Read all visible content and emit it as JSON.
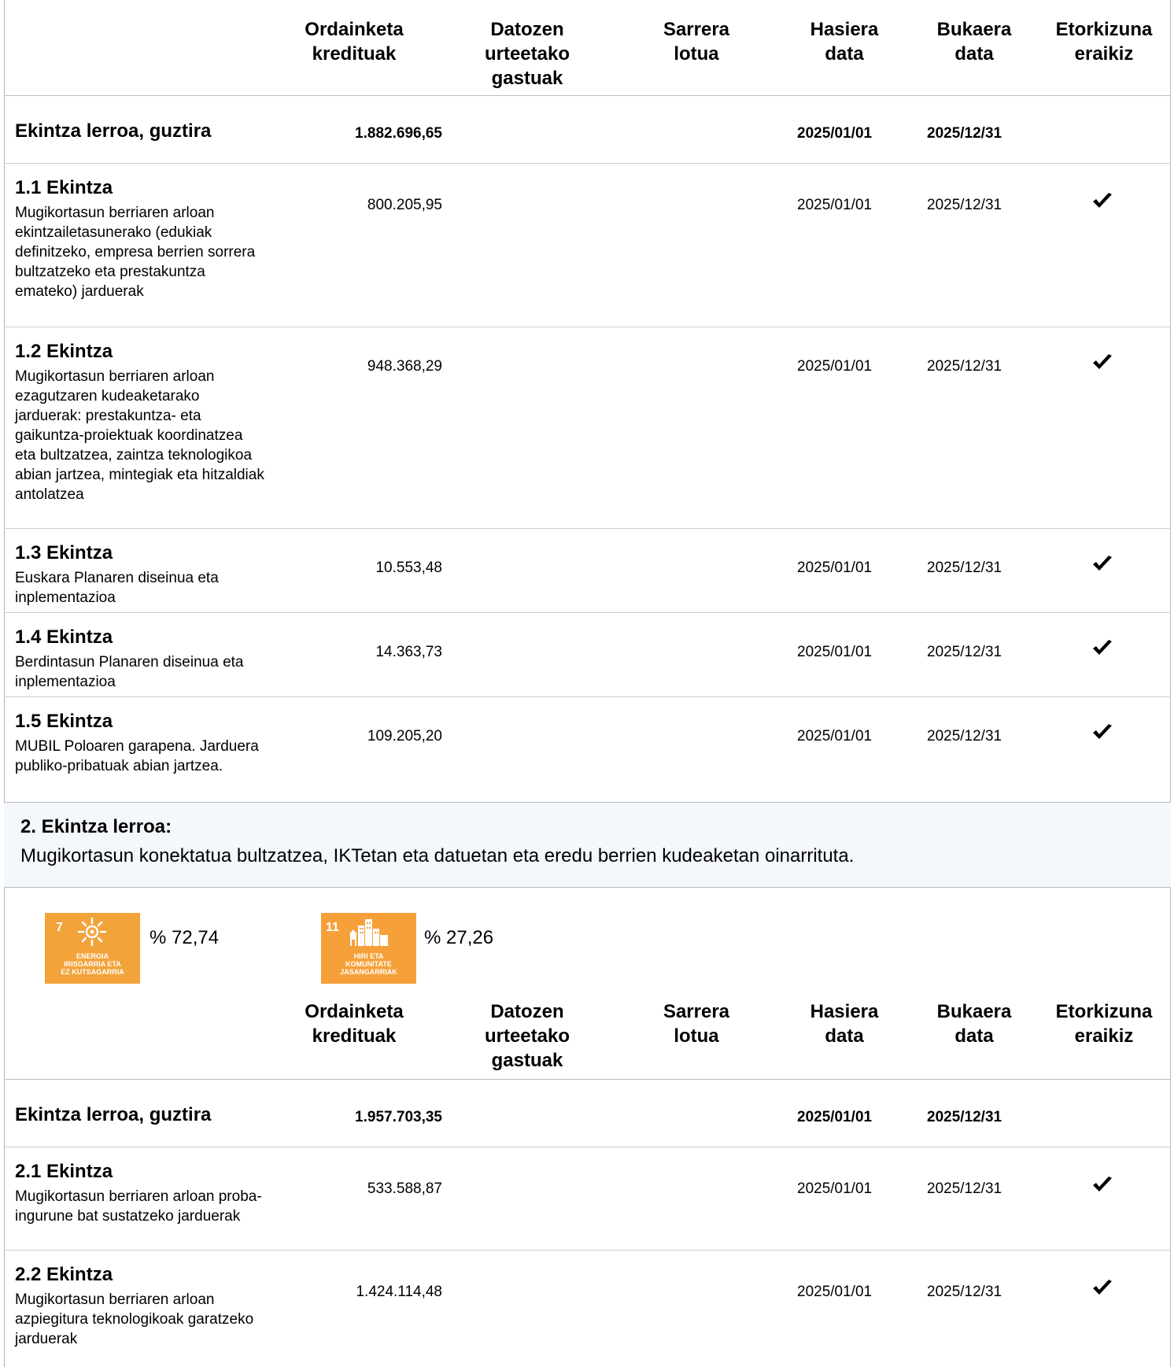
{
  "headers": {
    "credits": [
      "Ordainketa",
      "kredituak"
    ],
    "future": [
      "Datozen",
      "urteetako",
      "gastuak"
    ],
    "income": [
      "Sarrera",
      "lotua"
    ],
    "start": [
      "Hasiera",
      "data"
    ],
    "end": [
      "Bukaera",
      "data"
    ],
    "build": [
      "Etorkizuna",
      "eraikiz"
    ]
  },
  "line1": {
    "total": {
      "label": "Ekintza lerroa, guztira",
      "credits": "1.882.696,65",
      "start": "2025/01/01",
      "end": "2025/12/31"
    },
    "actions": [
      {
        "title": "1.1 Ekintza",
        "desc": "Mugikortasun berriaren arloan ekintzailetasunerako (edukiak definitzeko, empresa berrien sorrera bultzatzeko eta prestakuntza emateko) jarduerak",
        "credits": "800.205,95",
        "start": "2025/01/01",
        "end": "2025/12/31",
        "check": "✔"
      },
      {
        "title": "1.2 Ekintza",
        "desc": "Mugikortasun berriaren arloan ezagutzaren kudeaketarako jarduerak: prestakuntza- eta gaikuntza-proiektuak koordinatzea eta bultzatzea, zaintza teknologikoa abian jartzea, mintegiak eta hitzaldiak antolatzea",
        "credits": "948.368,29",
        "start": "2025/01/01",
        "end": "2025/12/31",
        "check": "✔"
      },
      {
        "title": "1.3 Ekintza",
        "desc": "Euskara Planaren diseinua eta inplementazioa",
        "credits": "10.553,48",
        "start": "2025/01/01",
        "end": "2025/12/31",
        "check": "✔"
      },
      {
        "title": "1.4 Ekintza",
        "desc": "Berdintasun Planaren diseinua eta inplementazioa",
        "credits": "14.363,73",
        "start": "2025/01/01",
        "end": "2025/12/31",
        "check": "✔"
      },
      {
        "title": "1.5 Ekintza",
        "desc": "MUBIL Poloaren garapena. Jarduera publiko-pribatuak abian jartzea.",
        "credits": "109.205,20",
        "start": "2025/01/01",
        "end": "2025/12/31",
        "check": "✔"
      }
    ]
  },
  "line2": {
    "title": "2. Ekintza lerroa:",
    "desc": "Mugikortasun konektatua bultzatzea, IKTetan eta datuetan eta eredu berrien kudeaketan oinarrituta.",
    "sdgs": [
      {
        "number": "7",
        "label": [
          "ENERGIA",
          "IRISGARRIA ETA",
          "EZ KUTSAGARRIA"
        ],
        "percent": "% 72,74",
        "icon": "sun-icon",
        "color": "#f2a33a"
      },
      {
        "number": "11",
        "label": [
          "HIRI ETA",
          "KOMUNITATE",
          "JASANGARRIAK"
        ],
        "percent": "% 27,26",
        "icon": "city-icon",
        "color": "#f6a03a"
      }
    ],
    "total": {
      "label": "Ekintza lerroa, guztira",
      "credits": "1.957.703,35",
      "start": "2025/01/01",
      "end": "2025/12/31"
    },
    "actions": [
      {
        "title": "2.1 Ekintza",
        "desc": "Mugikortasun berriaren arloan proba-ingurune bat sustatzeko jarduerak",
        "credits": "533.588,87",
        "start": "2025/01/01",
        "end": "2025/12/31",
        "check": "✔"
      },
      {
        "title": "2.2 Ekintza",
        "desc": "Mugikortasun berriaren arloan azpiegitura teknologikoak garatzeko jarduerak",
        "credits": "1.424.114,48",
        "start": "2025/01/01",
        "end": "2025/12/31",
        "check": "✔"
      }
    ]
  }
}
